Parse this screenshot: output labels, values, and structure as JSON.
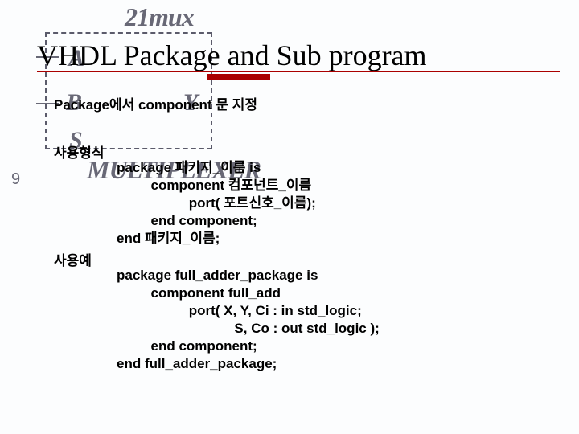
{
  "background": {
    "mux_title": "21mux",
    "port_a": "A",
    "port_b": "B",
    "port_y": "Y",
    "port_s": "S",
    "multiplexer": "MULTIPLEXER",
    "page_num": "9"
  },
  "slide": {
    "title": "VHDL Package and Sub program",
    "subtitle": "Package에서 component 문 지정",
    "section1_label": "사용형식",
    "code1": "package 패키지_이름 is\n         component 컴포넌트_이름\n                   port( 포트신호_이름);\n         end component;\nend 패키지_이름;",
    "section2_label": "사용예",
    "code2": "package full_adder_package is\n         component full_add\n                   port( X, Y, Ci : in std_logic;\n                               S, Co : out std_logic );\n         end component;\nend full_adder_package;"
  }
}
